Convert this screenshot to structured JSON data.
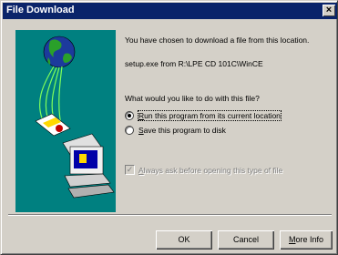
{
  "window": {
    "title": "File Download",
    "close_glyph": "×"
  },
  "message": {
    "intro": "You have chosen to download a file from this location.",
    "source": "setup.exe from R:\\LPE CD 101C\\WinCE",
    "question": "What would you like to do with this file?"
  },
  "options": {
    "run_first": "R",
    "run_rest": "un this program from its current location",
    "save_first": "S",
    "save_rest": "ave this program to disk",
    "selected": "run"
  },
  "always_ask": {
    "first": "A",
    "rest": "lways ask before opening this type of file",
    "checked": true,
    "enabled": false,
    "check_glyph": "✓"
  },
  "buttons": {
    "ok": "OK",
    "cancel": "Cancel",
    "more_first": "M",
    "more_rest": "ore Info"
  },
  "colors": {
    "titlebar": "#0a246a",
    "face": "#d4d0c8",
    "illustration_bg": "#008080"
  }
}
